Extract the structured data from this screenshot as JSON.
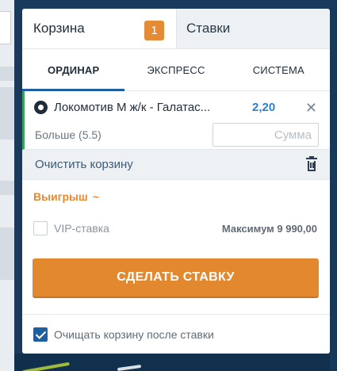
{
  "cart_tab": {
    "label": "Корзина",
    "count": "1"
  },
  "bets_tab": {
    "label": "Ставки"
  },
  "bet_types": [
    "ОРДИНАР",
    "ЭКСПРЕСС",
    "СИСТЕМА"
  ],
  "bet": {
    "event": "Локомотив М ж/к - Галатас...",
    "odds": "2,20",
    "market": "Больше (5.5)",
    "amount_placeholder": "Сумма",
    "amount_value": ""
  },
  "clear_label": "Очистить корзину",
  "win": {
    "label": "Выигрыш",
    "value": "~"
  },
  "vip": {
    "label": "VIP-ставка",
    "checked": false
  },
  "max_label": "Максимум 9 990,00",
  "place_button": "СДЕЛАТЬ СТАВКУ",
  "clear_after": {
    "label": "Очищать корзину после ставки",
    "checked": true
  },
  "colors": {
    "accent": "#e2882f",
    "active_tab": "#1f5fa0",
    "odds": "#2a7fd0",
    "bet_marker": "#3aa25a"
  }
}
